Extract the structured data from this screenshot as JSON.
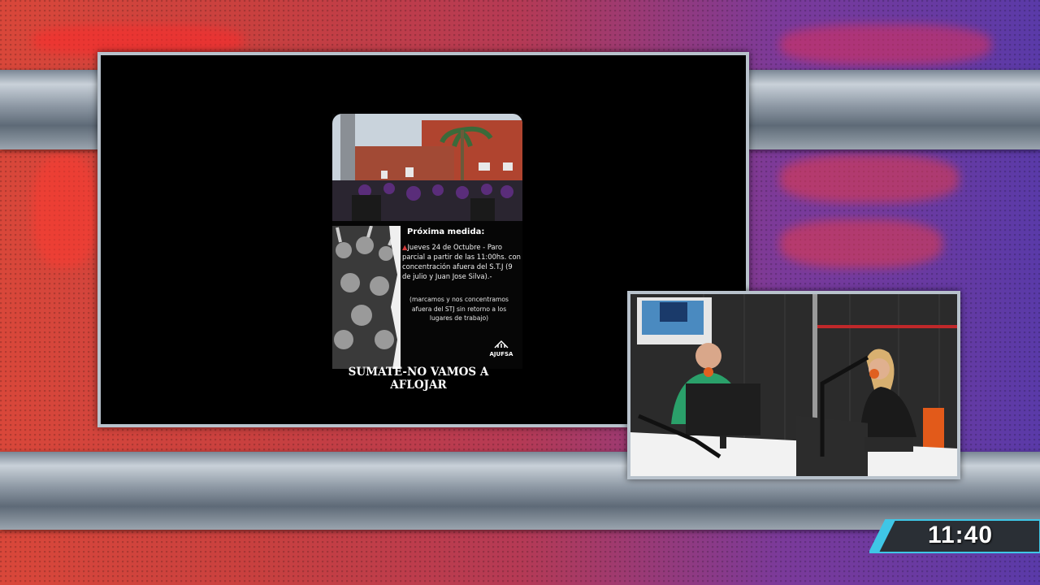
{
  "flyer": {
    "heading": "Próxima medida:",
    "body": "Jueves 24 de Octubre - Paro parcial a partir de las 11:00hs.  con concentración afuera del  S.T.J  (9 de julio y Juan Jose Silva).-",
    "note": "(marcamos  y nos concentramos afuera del STJ sin retorno a los lugares de trabajo)",
    "logo_text": "AJUFSA",
    "call_to_action": "SUMATE-NO VAMOS A AFLOJAR",
    "bullet_icon": "warning-triangle-icon"
  },
  "clock": {
    "time": "11:40"
  },
  "colors": {
    "background_left": "#d9473a",
    "background_right": "#5a3aa8",
    "clock_accent": "#3fc6e6",
    "frame_border": "#b8c2cc"
  }
}
